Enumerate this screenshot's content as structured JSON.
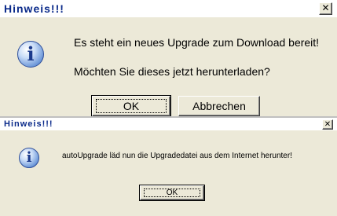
{
  "dialog1": {
    "title": "Hinweis!!!",
    "close_glyph": "✕",
    "icon": "info-icon",
    "icon_glyph": "i",
    "message_line1": "Es steht ein neues Upgrade zum Download bereit!",
    "message_line2": "Möchten Sie dieses jetzt herunterladen?",
    "ok_label": "OK",
    "cancel_label": "Abbrechen"
  },
  "dialog2": {
    "title": "Hinweis!!!",
    "close_glyph": "✕",
    "icon": "info-icon",
    "icon_glyph": "i",
    "message": "autoUpgrade läd nun die Upgradedatei aus dem Internet herunter!",
    "ok_label": "OK"
  },
  "colors": {
    "dialog_background": "#ece9d8",
    "title_text": "#0a2a8a",
    "icon_blue": "#6a96d8"
  }
}
